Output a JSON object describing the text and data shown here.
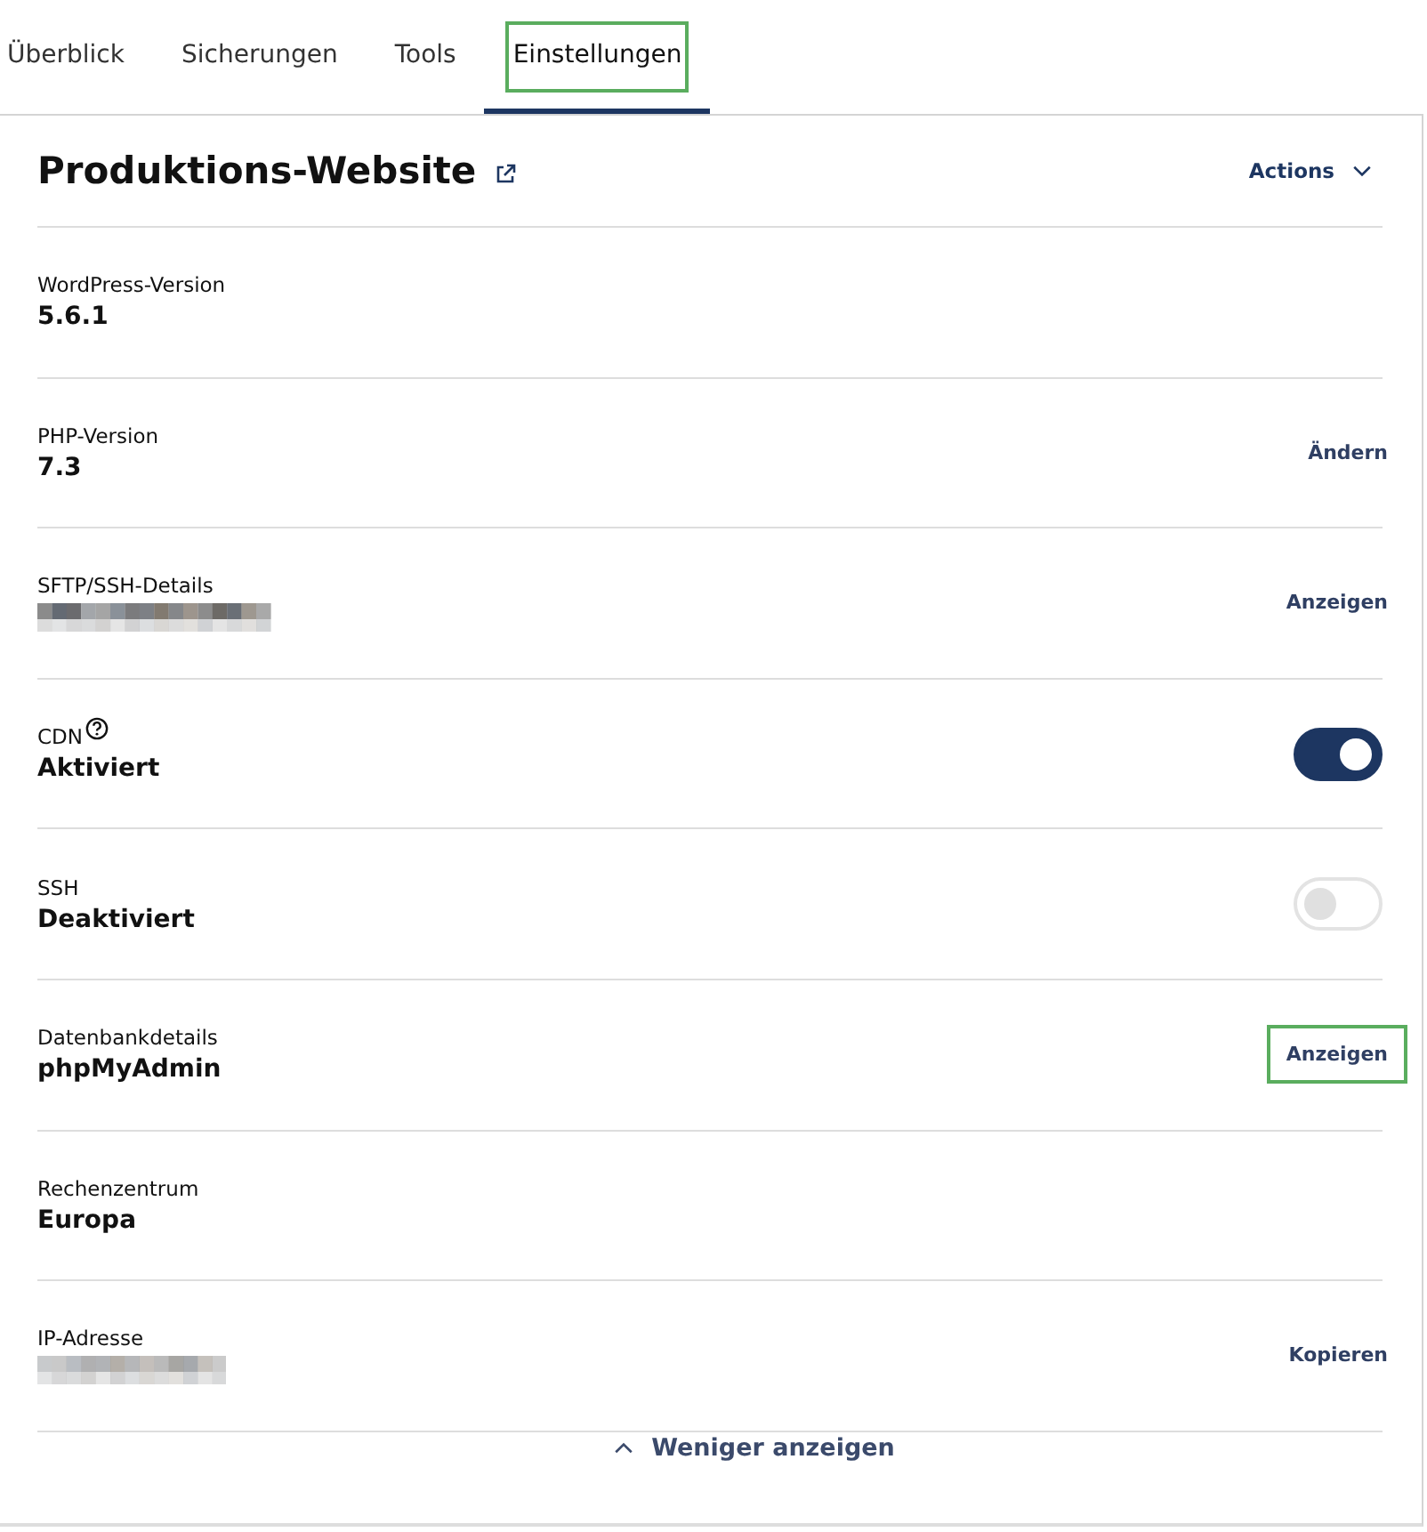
{
  "tabs": [
    {
      "label": "Überblick",
      "selected": false,
      "highlighted": false
    },
    {
      "label": "Sicherungen",
      "selected": false,
      "highlighted": false
    },
    {
      "label": "Tools",
      "selected": false,
      "highlighted": false
    },
    {
      "label": "Einstellungen",
      "selected": true,
      "highlighted": true
    }
  ],
  "site": {
    "title": "Produktions-Website",
    "actions": "Actions"
  },
  "rows": [
    {
      "kind": "plain",
      "label": "WordPress-Version",
      "value": "5.6.1"
    },
    {
      "kind": "link",
      "label": "PHP-Version",
      "value": "7.3",
      "action": "Ändern",
      "highlighted": false
    },
    {
      "kind": "link",
      "label": "SFTP/SSH-Details",
      "redacted": true,
      "action": "Anzeigen",
      "highlighted": false
    },
    {
      "kind": "toggle",
      "label": "CDN",
      "help": true,
      "value": "Aktiviert",
      "on": true
    },
    {
      "kind": "toggle",
      "label": "SSH",
      "value": "Deaktiviert",
      "on": false
    },
    {
      "kind": "link",
      "label": "Datenbankdetails",
      "value": "phpMyAdmin",
      "action": "Anzeigen",
      "highlighted": true
    },
    {
      "kind": "plain",
      "label": "Rechenzentrum",
      "value": "Europa"
    },
    {
      "kind": "link",
      "label": "IP-Adresse",
      "redacted": true,
      "action": "Kopieren",
      "highlighted": false
    }
  ],
  "less_link": "Weniger anzeigen"
}
